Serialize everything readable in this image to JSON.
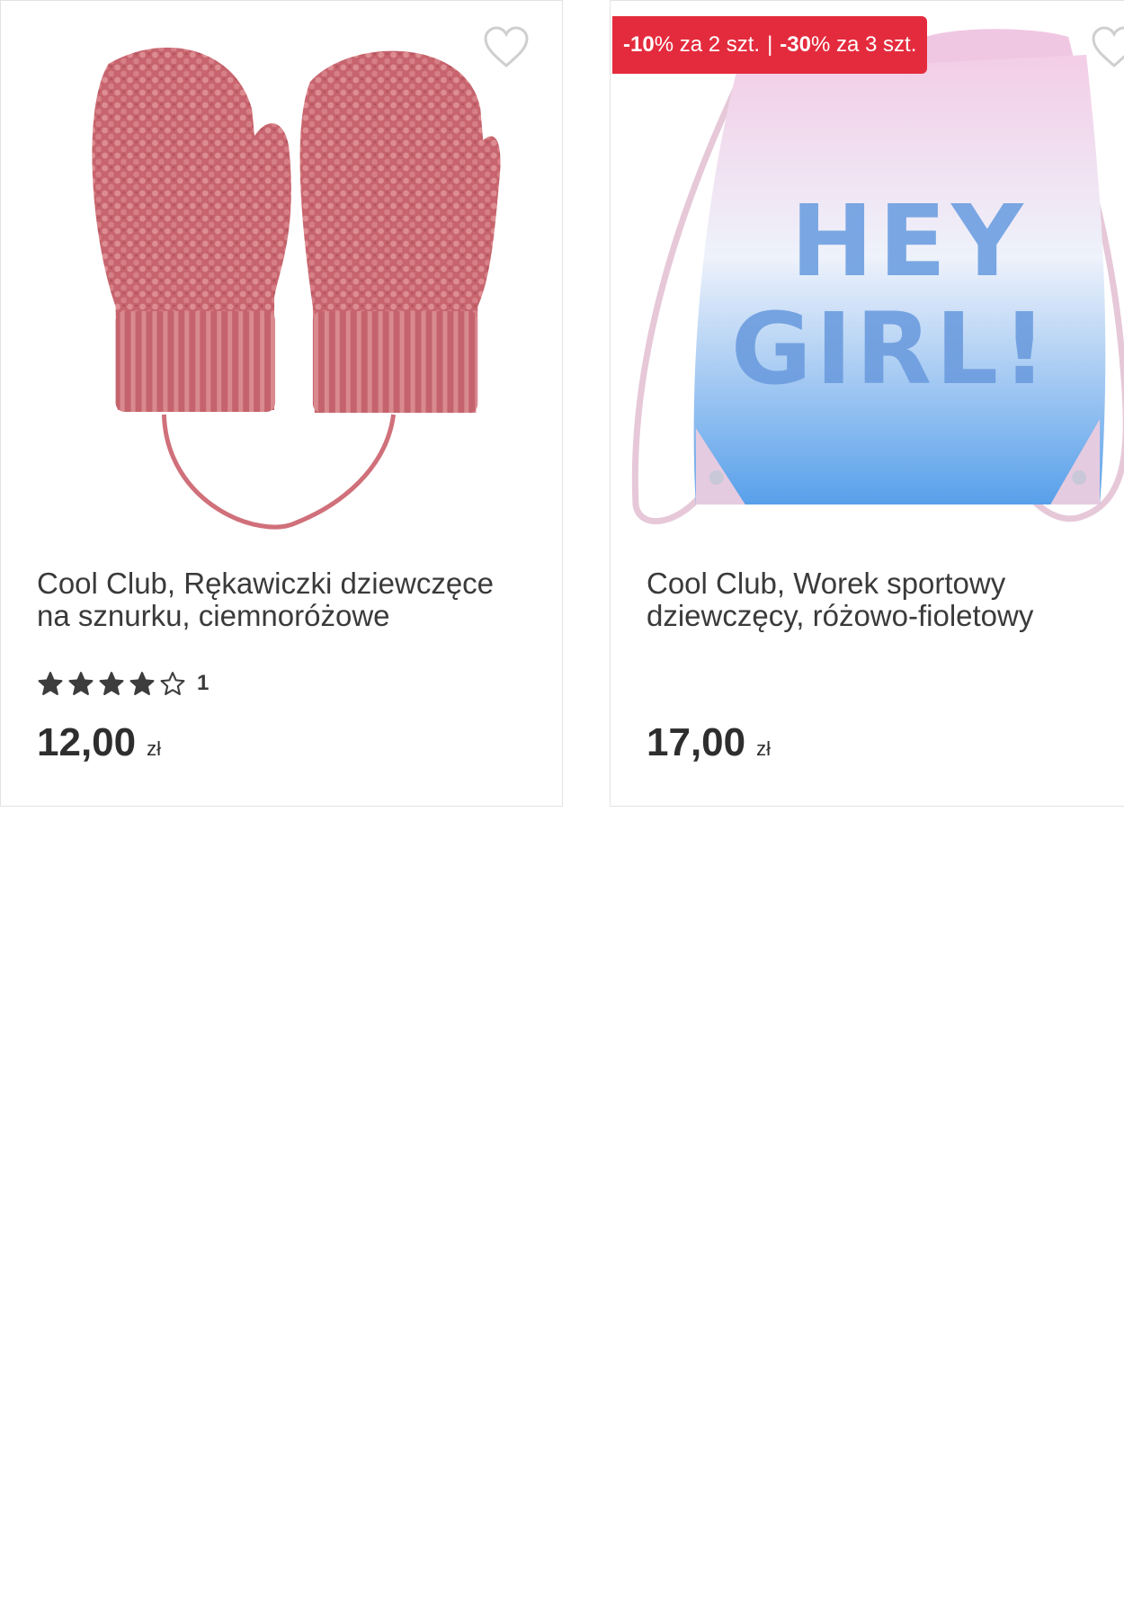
{
  "products": [
    {
      "title": "Cool Club, Rękawiczki dziewczęce na sznurku, ciemnoróżowe",
      "rating": 4,
      "rating_max": 5,
      "rating_count": "1",
      "price": "12,00",
      "currency": "zł",
      "image_icon": "knitted-mittens-image",
      "colors": {
        "mitten": "#c96b72"
      }
    },
    {
      "title": "Cool Club, Worek sportowy dziewczęcy, różowo-fioletowy",
      "price": "17,00",
      "currency": "zł",
      "image_icon": "drawstring-bag-image",
      "image_text": "HEY GIRL!",
      "promo": {
        "part1_bold": "-10",
        "part1_suffix": "% za 2 szt.",
        "separator": "|",
        "part2_bold": "-30",
        "part2_suffix": "% za 3 szt."
      },
      "colors": {
        "badge": "#e42b3d",
        "bag_top": "#f2cfe6",
        "bag_bottom": "#5aa0e8"
      }
    }
  ]
}
